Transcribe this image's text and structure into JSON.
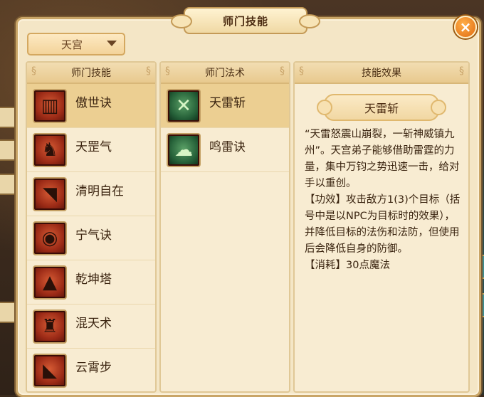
{
  "window": {
    "title": "师门技能",
    "close_icon": "close-icon"
  },
  "sect_dropdown": {
    "selected": "天宫"
  },
  "columns": {
    "skills_header": "师门技能",
    "spells_header": "师门法术",
    "effect_header": "技能效果"
  },
  "skills": [
    {
      "name": "傲世诀",
      "icon": "scroll-icon",
      "glyph": "▥"
    },
    {
      "name": "天罡气",
      "icon": "warrior-icon",
      "glyph": "♞"
    },
    {
      "name": "清明自在",
      "icon": "signal-icon",
      "glyph": "◥"
    },
    {
      "name": "宁气诀",
      "icon": "orb-icon",
      "glyph": "◉"
    },
    {
      "name": "乾坤塔",
      "icon": "pagoda-icon",
      "glyph": "▲"
    },
    {
      "name": "混天术",
      "icon": "tower-icon",
      "glyph": "♜"
    },
    {
      "name": "云霄步",
      "icon": "boot-icon",
      "glyph": "◣"
    }
  ],
  "spells": [
    {
      "name": "天雷斩",
      "icon": "thunder-blade-icon",
      "glyph": "✕"
    },
    {
      "name": "鸣雷诀",
      "icon": "cloud-thunder-icon",
      "glyph": "☁"
    }
  ],
  "effect": {
    "title": "天雷斩",
    "description": "“天雷怒震山崩裂，一斩神威镇九州”。天宫弟子能够借助雷霆的力量，集中万钧之势迅速一击，给对手以重创。\n【功效】攻击敌方1(3)个目标（括号中是以NPC为目标时的效果），并降低目标的法伤和法防，但使用后会降低自身的防御。\n【消耗】30点魔法"
  },
  "colors": {
    "panel": "#f4e6c6",
    "selected_row": "#eccf92",
    "close_button": "#e06a10"
  }
}
